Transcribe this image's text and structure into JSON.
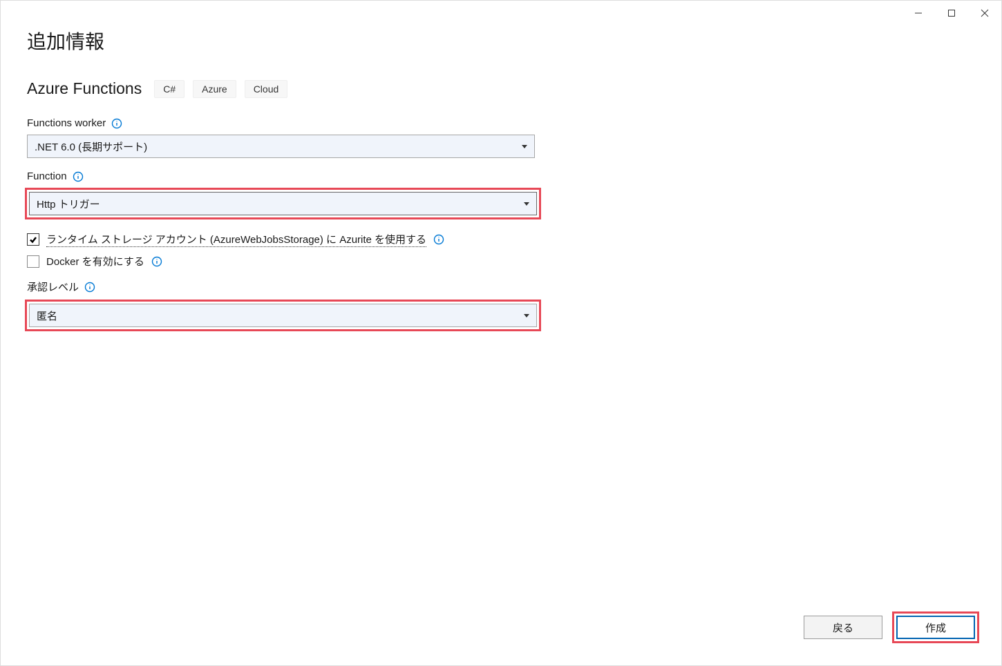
{
  "page_title": "追加情報",
  "subtitle": "Azure Functions",
  "tags": [
    "C#",
    "Azure",
    "Cloud"
  ],
  "fields": {
    "worker": {
      "label": "Functions worker",
      "value": ".NET 6.0 (長期サポート)"
    },
    "function": {
      "label": "Function",
      "value": "Http トリガー"
    },
    "auth_level": {
      "label": "承認レベル",
      "value": "匿名"
    }
  },
  "checkboxes": {
    "azurite": {
      "label": "ランタイム ストレージ アカウント (AzureWebJobsStorage) に Azurite を使用する",
      "checked": true
    },
    "docker": {
      "label": "Docker を有効にする",
      "checked": false
    }
  },
  "footer": {
    "back": "戻る",
    "create": "作成"
  }
}
